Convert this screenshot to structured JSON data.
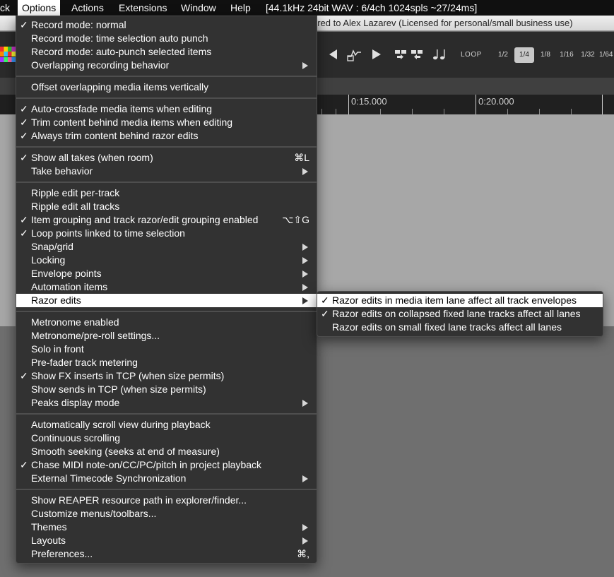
{
  "menubar": {
    "items": [
      {
        "label": "ck",
        "active": false
      },
      {
        "label": "Options",
        "active": true
      },
      {
        "label": "Actions",
        "active": false
      },
      {
        "label": "Extensions",
        "active": false
      },
      {
        "label": "Window",
        "active": false
      },
      {
        "label": "Help",
        "active": false
      }
    ],
    "status": "[44.1kHz 24bit WAV : 6/4ch 1024spls ~27/24ms]"
  },
  "window": {
    "title_fragment": "ered to Alex Lazarev (Licensed for personal/small business use)"
  },
  "toolbar": {
    "loop_label": "LOOP",
    "grid_divisions": [
      "1/2",
      "1/4",
      "1/8",
      "1/16",
      "1/32",
      "1/64"
    ],
    "grid_selected": "1/4"
  },
  "ruler": {
    "marks": [
      "0:15.000",
      "0:20.000"
    ]
  },
  "options_menu": {
    "groups": [
      [
        {
          "label": "Record mode: normal",
          "checked": true
        },
        {
          "label": "Record mode: time selection auto punch",
          "checked": false
        },
        {
          "label": "Record mode: auto-punch selected items",
          "checked": false
        },
        {
          "label": "Overlapping recording behavior",
          "checked": false,
          "submenu": true
        }
      ],
      [
        {
          "label": "Offset overlapping media items vertically",
          "checked": false
        }
      ],
      [
        {
          "label": "Auto-crossfade media items when editing",
          "checked": true
        },
        {
          "label": "Trim content behind media items when editing",
          "checked": true
        },
        {
          "label": "Always trim content behind razor edits",
          "checked": true
        }
      ],
      [
        {
          "label": "Show all takes (when room)",
          "checked": true,
          "shortcut": "⌘L"
        },
        {
          "label": "Take behavior",
          "checked": false,
          "submenu": true
        }
      ],
      [
        {
          "label": "Ripple edit per-track",
          "checked": false
        },
        {
          "label": "Ripple edit all tracks",
          "checked": false
        },
        {
          "label": "Item grouping and track razor/edit grouping enabled",
          "checked": true,
          "shortcut": "⌥⇧G"
        },
        {
          "label": "Loop points linked to time selection",
          "checked": true
        },
        {
          "label": "Snap/grid",
          "checked": false,
          "submenu": true
        },
        {
          "label": "Locking",
          "checked": false,
          "submenu": true
        },
        {
          "label": "Envelope points",
          "checked": false,
          "submenu": true
        },
        {
          "label": "Automation items",
          "checked": false,
          "submenu": true
        },
        {
          "label": "Razor edits",
          "checked": false,
          "submenu": true,
          "highlight": true
        }
      ],
      [
        {
          "label": "Metronome enabled",
          "checked": false
        },
        {
          "label": "Metronome/pre-roll settings...",
          "checked": false
        },
        {
          "label": "Solo in front",
          "checked": false
        },
        {
          "label": "Pre-fader track metering",
          "checked": false
        },
        {
          "label": "Show FX inserts in TCP (when size permits)",
          "checked": true
        },
        {
          "label": "Show sends in TCP (when size permits)",
          "checked": false
        },
        {
          "label": "Peaks display mode",
          "checked": false,
          "submenu": true
        }
      ],
      [
        {
          "label": "Automatically scroll view during playback",
          "checked": false
        },
        {
          "label": "Continuous scrolling",
          "checked": false
        },
        {
          "label": "Smooth seeking (seeks at end of measure)",
          "checked": false
        },
        {
          "label": "Chase MIDI note-on/CC/PC/pitch in project playback",
          "checked": true
        },
        {
          "label": "External Timecode Synchronization",
          "checked": false,
          "submenu": true
        }
      ],
      [
        {
          "label": "Show REAPER resource path in explorer/finder...",
          "checked": false
        },
        {
          "label": "Customize menus/toolbars...",
          "checked": false
        },
        {
          "label": "Themes",
          "checked": false,
          "submenu": true
        },
        {
          "label": "Layouts",
          "checked": false,
          "submenu": true
        },
        {
          "label": "Preferences...",
          "checked": false,
          "shortcut": "⌘,"
        }
      ]
    ]
  },
  "razor_submenu": {
    "items": [
      {
        "label": "Razor edits in media item lane affect all track envelopes",
        "checked": true,
        "highlight": true
      },
      {
        "label": "Razor edits on collapsed fixed lane tracks affect all lanes",
        "checked": true
      },
      {
        "label": "Razor edits on small fixed lane tracks affect all lanes",
        "checked": false
      }
    ]
  },
  "check_glyph": "✓",
  "colors": {
    "menu_bg": "#323232",
    "highlight_bg": "#ffffff",
    "menubar_bg": "#101010"
  }
}
